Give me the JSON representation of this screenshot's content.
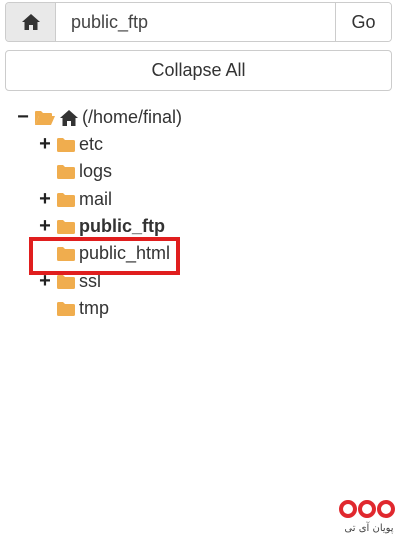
{
  "path_bar": {
    "home_icon": "home-icon",
    "path_value": "public_ftp",
    "go_label": "Go"
  },
  "collapse_label": "Collapse All",
  "tree": {
    "root": {
      "label": "(/home/final)",
      "toggle": "−",
      "icon": "folder-open-icon",
      "home_icon": "home-icon"
    },
    "children": [
      {
        "label": "etc",
        "toggle": "+",
        "bold": false
      },
      {
        "label": "logs",
        "toggle": "",
        "bold": false
      },
      {
        "label": "mail",
        "toggle": "+",
        "bold": false
      },
      {
        "label": "public_ftp",
        "toggle": "+",
        "bold": true
      },
      {
        "label": "public_html",
        "toggle": "",
        "bold": false,
        "highlighted": true
      },
      {
        "label": "ssl",
        "toggle": "+",
        "bold": false
      },
      {
        "label": "tmp",
        "toggle": "",
        "bold": false
      }
    ]
  },
  "colors": {
    "folder": "#f0ad4e",
    "highlight_border": "#e01e1e",
    "button_bg": "#e9e9e9",
    "border": "#cccccc"
  },
  "watermark": {
    "text": "پویان آی تی"
  }
}
